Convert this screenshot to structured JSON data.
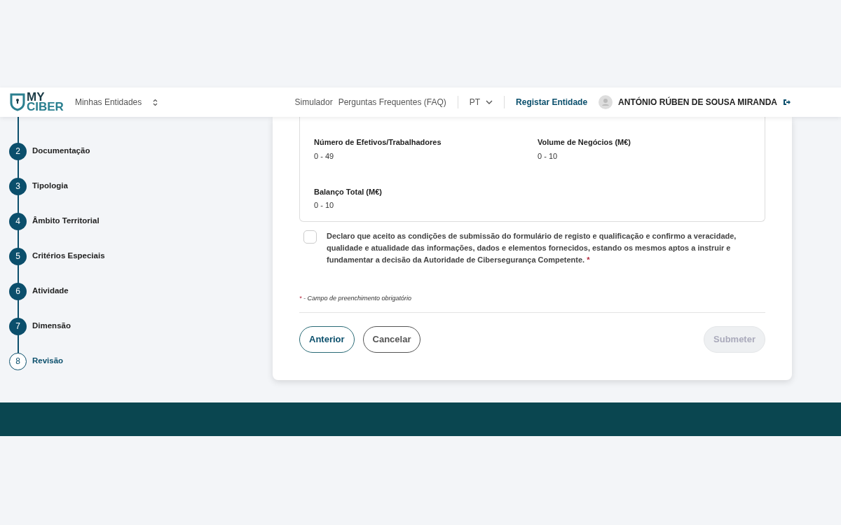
{
  "header": {
    "logo": {
      "line1": "MY",
      "line2": "CIBER"
    },
    "entity_selector": "Minhas Entidades",
    "links": [
      "Simulador",
      "Perguntas Frequentes (FAQ)"
    ],
    "language": "PT",
    "register_link": "Registar Entidade",
    "user_name": "ANTÓNIO RÚBEN DE SOUSA MIRANDA"
  },
  "steps": [
    {
      "number": "2",
      "label": "Documentação",
      "selected": false
    },
    {
      "number": "3",
      "label": "Tipologia",
      "selected": false
    },
    {
      "number": "4",
      "label": "Âmbito Territorial",
      "selected": false
    },
    {
      "number": "5",
      "label": "Critérios Especiais",
      "selected": false
    },
    {
      "number": "6",
      "label": "Atividade",
      "selected": false
    },
    {
      "number": "7",
      "label": "Dimensão",
      "selected": false
    },
    {
      "number": "8",
      "label": "Revisão",
      "selected": true
    }
  ],
  "fields": [
    {
      "label": "Número de Efetivos/Trabalhadores",
      "value": "0 - 49"
    },
    {
      "label": "Volume de Negócios (M€)",
      "value": "0 - 10"
    },
    {
      "label": "Balanço Total (M€)",
      "value": "0 - 10"
    }
  ],
  "declaration": {
    "checked": false,
    "text": "Declaro que aceito as condições de submissão do formulário de registo e qualificação e confirmo a veracidade, qualidade e atualidade das informações, dados e elementos fornecidos, estando os mesmos aptos a instruir e fundamentar a decisão da Autoridade de Cibersegurança Competente.",
    "required_mark": "*"
  },
  "required_note": {
    "mark": "*",
    "text": "- Campo de preenchimento obrigatório"
  },
  "buttons": [
    {
      "label": "Anterior",
      "kind": "outline",
      "disabled": false
    },
    {
      "label": "Cancelar",
      "kind": "secondary",
      "disabled": false
    },
    {
      "label": "Submeter",
      "kind": "primary",
      "disabled": true
    }
  ]
}
